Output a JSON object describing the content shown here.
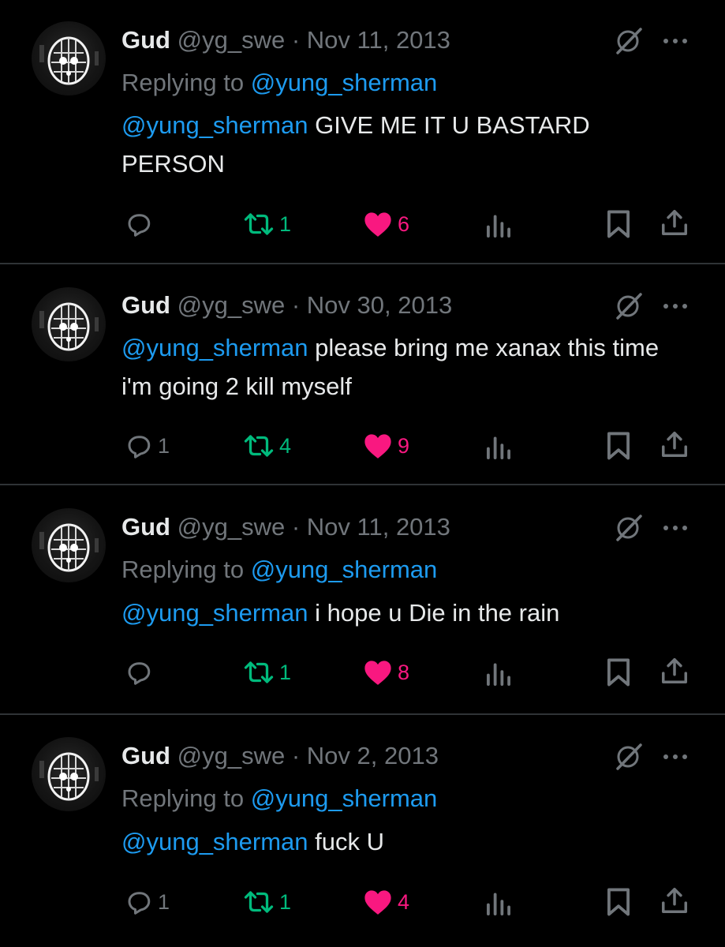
{
  "colors": {
    "background": "#000000",
    "text": "#e7e9ea",
    "secondary": "#71767b",
    "link": "#1d9bf0",
    "retweet": "#00ba7c",
    "like": "#f91880",
    "divider": "#2f3336"
  },
  "icons": [
    "avatar-image",
    "grok-icon",
    "more-icon",
    "reply-icon",
    "retweet-icon",
    "heart-icon",
    "views-icon",
    "bookmark-icon",
    "share-icon"
  ],
  "tweets": [
    {
      "name": "Gud",
      "handle": "@yg_swe",
      "separator": "·",
      "date": "Nov 11, 2013",
      "replying_prefix": "Replying to",
      "replying_handle": "@yung_sherman",
      "mention": "@yung_sherman",
      "text": " GIVE ME IT U BASTARD PERSON",
      "reply_count": "",
      "retweet_count": "1",
      "like_count": "6"
    },
    {
      "name": "Gud",
      "handle": "@yg_swe",
      "separator": "·",
      "date": "Nov 30, 2013",
      "replying_prefix": "",
      "replying_handle": "",
      "mention": "@yung_sherman",
      "text": " please bring me xanax this time i'm going 2 kill myself",
      "reply_count": "1",
      "retweet_count": "4",
      "like_count": "9"
    },
    {
      "name": "Gud",
      "handle": "@yg_swe",
      "separator": "·",
      "date": "Nov 11, 2013",
      "replying_prefix": "Replying to",
      "replying_handle": "@yung_sherman",
      "mention": "@yung_sherman",
      "text": " i hope u Die in the rain",
      "reply_count": "",
      "retweet_count": "1",
      "like_count": "8"
    },
    {
      "name": "Gud",
      "handle": "@yg_swe",
      "separator": "·",
      "date": "Nov 2, 2013",
      "replying_prefix": "Replying to",
      "replying_handle": "@yung_sherman",
      "mention": "@yung_sherman",
      "text": " fuck U",
      "reply_count": "1",
      "retweet_count": "1",
      "like_count": "4"
    }
  ]
}
